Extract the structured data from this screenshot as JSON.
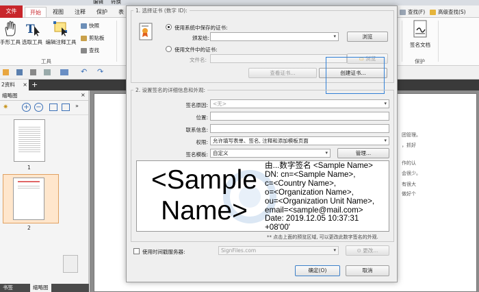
{
  "title_fragments": [
    "编辑",
    "转换"
  ],
  "menu": {
    "file": "文件",
    "start": "开始",
    "view": "视图",
    "annotate": "注释",
    "protect": "保护",
    "table": "表"
  },
  "ribbon": {
    "hand_tool": "手形工具",
    "select_tool": "选取工具",
    "edit_annot_tool": "编辑注释工具",
    "snapshot": "快照",
    "clipboard": "剪贴板",
    "find": "查找",
    "group_tools": "工具",
    "right_find": "查找(F)",
    "advanced_find": "高级查找(S)",
    "sign_doc": "签名文档",
    "group_protect": "保护"
  },
  "doc_tab": "2资料",
  "thumb_panel": {
    "title": "缩略图",
    "page1": "1",
    "page2": "2"
  },
  "bottom_tabs": {
    "bookmarks": "书签",
    "thumbnails": "缩略图"
  },
  "page_text": [
    "团管理。",
    "，抓好",
    "",
    "作的认",
    "会很少。",
    "有很大",
    "做好个"
  ],
  "dialog": {
    "section1": "1. 选择证书 (数字 ID):",
    "use_system_cert": "使用系统中保存的证书:",
    "issuer_label": "颁发给:",
    "issuer_value": "",
    "browse1": "浏览",
    "use_file_cert": "使用文件中的证书:",
    "filename_label": "文件名:",
    "filename_value": "",
    "browse2": "浏览",
    "view_cert": "查看证书...",
    "create_cert": "创建证书...",
    "section2": "2. 设置签名的详细信息和外观:",
    "reason_label": "签名原因:",
    "reason_value": "<无>",
    "location_label": "位置:",
    "contact_label": "联系信息:",
    "perm_label": "权限:",
    "perm_value": "允许填写表单、签名, 注释和添加模板页面",
    "template_label": "签名模板:",
    "template_value": "自定义",
    "manage": "管理...",
    "preview_name_line1": "<Sample",
    "preview_name_line2": "Name>",
    "preview_details": [
      "由...数字签名 <Sample Name>",
      "DN: cn=<Sample Name>,",
      "c=<Country Name>,",
      "o=<Organization Name>,",
      "ou=<Organization Unit Name>,",
      "email=<sample@mail.com>",
      "Date: 2019.12.05 10:37:31",
      "+08'00'"
    ],
    "preview_hint": "** 点击上面的预览区域, 可以更改此数字签名的外观.",
    "timestamp_label": "使用时间戳服务器:",
    "timestamp_value": "SignFiles.com",
    "change": "更改...",
    "ok": "确定(O)",
    "cancel": "取消"
  }
}
